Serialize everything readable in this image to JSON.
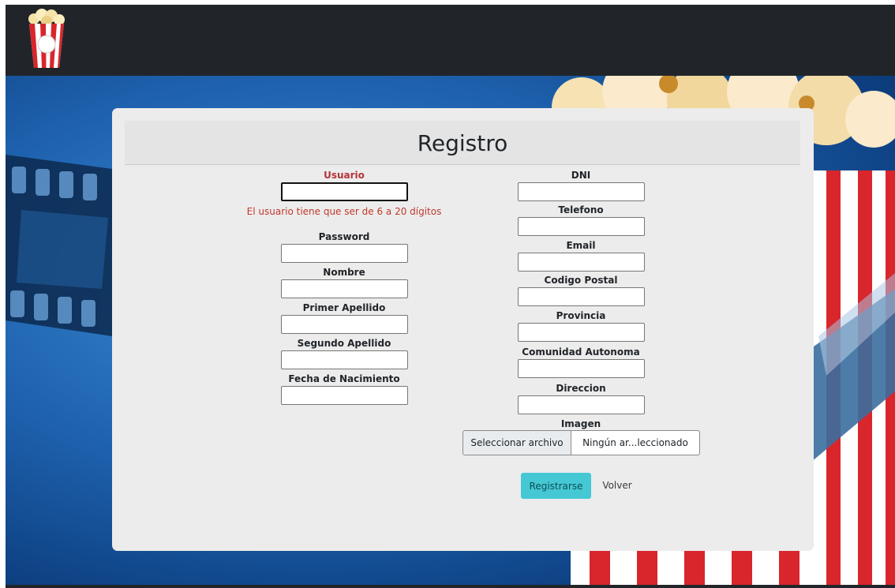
{
  "form": {
    "title": "Registro",
    "left_fields": [
      {
        "label": "Usuario",
        "value": ""
      },
      {
        "label": "Password",
        "value": ""
      },
      {
        "label": "Nombre",
        "value": ""
      },
      {
        "label": "Primer Apellido",
        "value": ""
      },
      {
        "label": "Segundo Apellido",
        "value": ""
      },
      {
        "label": "Fecha de Nacimiento",
        "value": ""
      }
    ],
    "usuario_error": "El usuario tiene que ser de 6 a 20 dígitos",
    "right_fields": [
      {
        "label": "DNI",
        "value": ""
      },
      {
        "label": "Telefono",
        "value": ""
      },
      {
        "label": "Email",
        "value": ""
      },
      {
        "label": "Codigo Postal",
        "value": ""
      },
      {
        "label": "Provincia",
        "value": ""
      },
      {
        "label": "Comunidad Autonoma",
        "value": ""
      },
      {
        "label": "Direccion",
        "value": ""
      }
    ],
    "image": {
      "label": "Imagen",
      "button_label": "Seleccionar archivo",
      "file_name": "Ningún ar...leccionado"
    },
    "actions": {
      "register_label": "Registrarse",
      "back_label": "Volver"
    }
  },
  "colors": {
    "navbar": "#212529",
    "error": "#c0392b",
    "register_button": "#45c8d3"
  },
  "icons": {
    "logo": "popcorn-bucket-logo"
  }
}
